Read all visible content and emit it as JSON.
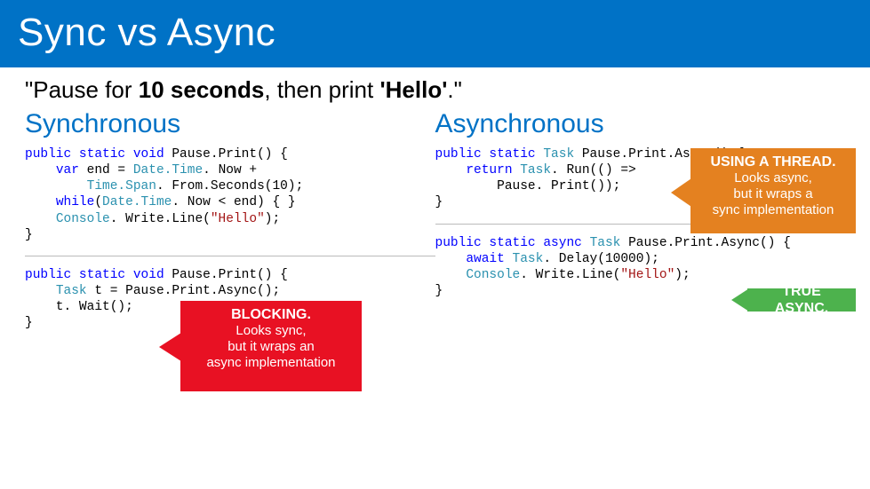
{
  "slide": {
    "title": "Sync vs Async",
    "subtitle_prefix": "\"Pause for ",
    "subtitle_bold": "10 seconds",
    "subtitle_mid": ", then print ",
    "subtitle_bold2": "'Hello'",
    "subtitle_suffix": ".\""
  },
  "left": {
    "heading": "Synchronous",
    "code1": {
      "l1a": "public",
      "l1b": " ",
      "l1c": "static",
      "l1d": " ",
      "l1e": "void",
      "l1f": " Pause.Print() {",
      "l2a": "    ",
      "l2b": "var",
      "l2c": " end = ",
      "l2d": "Date.Time",
      "l2e": ". Now +",
      "l3a": "        ",
      "l3b": "Time.Span",
      "l3c": ". From.Seconds(10);",
      "l4a": "    ",
      "l4b": "while",
      "l4c": "(",
      "l4d": "Date.Time",
      "l4e": ". Now < end) { }",
      "l5a": "    ",
      "l5b": "Console",
      "l5c": ". Write.Line(",
      "l5d": "\"Hello\"",
      "l5e": ");",
      "l6": "}"
    },
    "code2": {
      "l1a": "public",
      "l1b": " ",
      "l1c": "static",
      "l1d": " ",
      "l1e": "void",
      "l1f": " Pause.Print() {",
      "l2a": "    ",
      "l2b": "Task",
      "l2c": " t = Pause.Print.Async();",
      "l3": "    t. Wait();",
      "l4": "}"
    }
  },
  "right": {
    "heading": "Asynchronous",
    "code1": {
      "l1a": "public",
      "l1b": " ",
      "l1c": "static",
      "l1d": " ",
      "l1e": "Task",
      "l1f": " Pause.Print.Async() {",
      "l2a": "    ",
      "l2b": "return",
      "l2c": " ",
      "l2d": "Task",
      "l2e": ". Run(() =>",
      "l3": "        Pause. Print());",
      "l4": "}"
    },
    "code2": {
      "l1a": "public",
      "l1b": " ",
      "l1c": "static",
      "l1d": " ",
      "l1e": "async",
      "l1f": " ",
      "l1g": "Task",
      "l1h": " Pause.Print.Async() {",
      "l2a": "    ",
      "l2b": "await",
      "l2c": " ",
      "l2d": "Task",
      "l2e": ". Delay(10000);",
      "l3a": "    ",
      "l3b": "Console",
      "l3c": ". Write.Line(",
      "l3d": "\"Hello\"",
      "l3e": ");",
      "l4": "}"
    }
  },
  "callouts": {
    "orange": {
      "hdr": "USING A THREAD.",
      "l1": "Looks async,",
      "l2": "but it wraps a",
      "l3": "sync implementation"
    },
    "red": {
      "hdr": "BLOCKING.",
      "l1": "Looks sync,",
      "l2": "but it wraps an",
      "l3": "async implementation"
    },
    "green": {
      "hdr": "TRUE ASYNC."
    }
  }
}
